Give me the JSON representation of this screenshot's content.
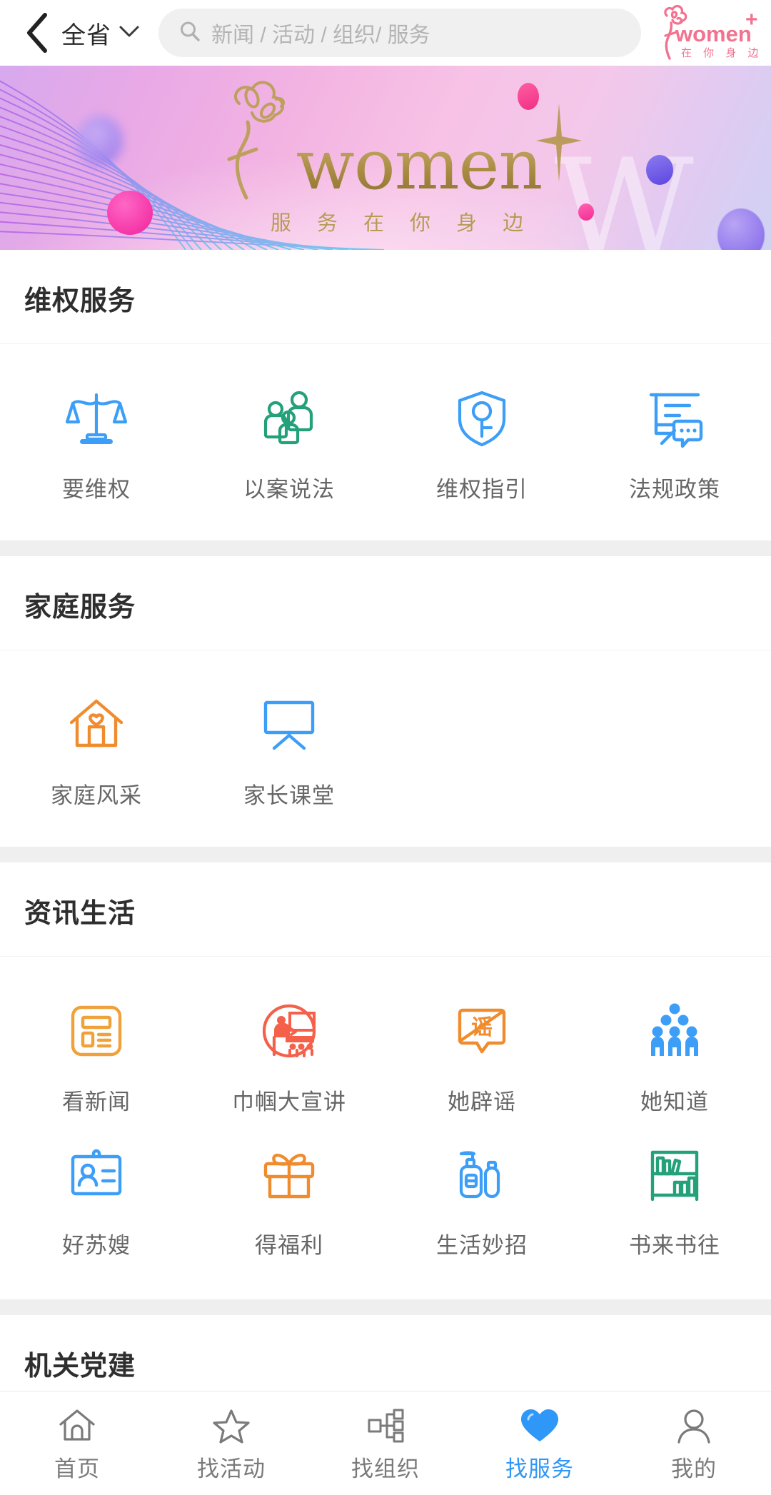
{
  "header": {
    "back_icon": "chevron-left-icon",
    "region_label": "全省",
    "region_chevron_icon": "chevron-down-icon",
    "search": {
      "icon": "search-icon",
      "placeholder": "新闻 / 活动 / 组织/ 服务",
      "value": ""
    },
    "logo": {
      "word": "women",
      "plus": "+",
      "tagline": "在 你 身 边",
      "color": "#f2728f"
    }
  },
  "banner": {
    "word": "women",
    "subtitle": "服 务 在 你 身 边",
    "gold_color": "#a98b42",
    "ghost_glyph": "W"
  },
  "sections": [
    {
      "title": "维权服务",
      "items": [
        {
          "label": "要维权",
          "icon": "balance-scale-icon",
          "color": "#3d9ef7"
        },
        {
          "label": "以案说法",
          "icon": "people-group-icon",
          "color": "#24a07a"
        },
        {
          "label": "维权指引",
          "icon": "shield-female-icon",
          "color": "#3d9ef7"
        },
        {
          "label": "法规政策",
          "icon": "document-chat-icon",
          "color": "#3d9ef7"
        }
      ]
    },
    {
      "title": "家庭服务",
      "items": [
        {
          "label": "家庭风采",
          "icon": "home-heart-icon",
          "color": "#f08c2e"
        },
        {
          "label": "家长课堂",
          "icon": "whiteboard-icon",
          "color": "#3d9ef7"
        }
      ]
    },
    {
      "title": "资讯生活",
      "items": [
        {
          "label": "看新闻",
          "icon": "newspaper-icon",
          "color": "#f0a13a"
        },
        {
          "label": "巾帼大宣讲",
          "icon": "lecture-circle-icon",
          "color": "#f4604a"
        },
        {
          "label": "她辟谣",
          "icon": "rumor-bubble-icon",
          "color": "#f08c2e"
        },
        {
          "label": "她知道",
          "icon": "crowd-icon",
          "color": "#3d9ef7"
        },
        {
          "label": "好苏嫂",
          "icon": "id-badge-icon",
          "color": "#3d9ef7"
        },
        {
          "label": "得福利",
          "icon": "gift-icon",
          "color": "#f08c2e"
        },
        {
          "label": "生活妙招",
          "icon": "bottles-icon",
          "color": "#3d9ef7"
        },
        {
          "label": "书来书往",
          "icon": "bookshelf-icon",
          "color": "#24a07a"
        }
      ]
    },
    {
      "title": "机关党建",
      "items": []
    }
  ],
  "tabbar": {
    "active_color": "#2f97f7",
    "inactive_color": "#7a7a7a",
    "tabs": [
      {
        "label": "首页",
        "icon": "home-icon",
        "active": false
      },
      {
        "label": "找活动",
        "icon": "star-icon",
        "active": false
      },
      {
        "label": "找组织",
        "icon": "org-tree-icon",
        "active": false
      },
      {
        "label": "找服务",
        "icon": "heart-icon",
        "active": true
      },
      {
        "label": "我的",
        "icon": "person-icon",
        "active": false
      }
    ]
  }
}
